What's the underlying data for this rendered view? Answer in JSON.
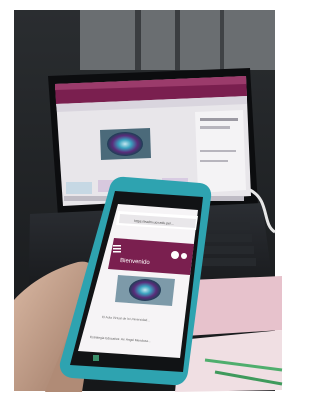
{
  "phone": {
    "url": "https://eadm.ucv.edu.pe/...",
    "page_heading": "Bienvenido",
    "body_text": "El Aula Virtual de la Universidad...",
    "bottom_text": "Estrategia Educativa: Av. Angel Mendoza..."
  },
  "colors": {
    "site_theme": "#7a1f4f",
    "phone_case": "#2ea3b0",
    "laptop_body": "#1a1c1e"
  }
}
